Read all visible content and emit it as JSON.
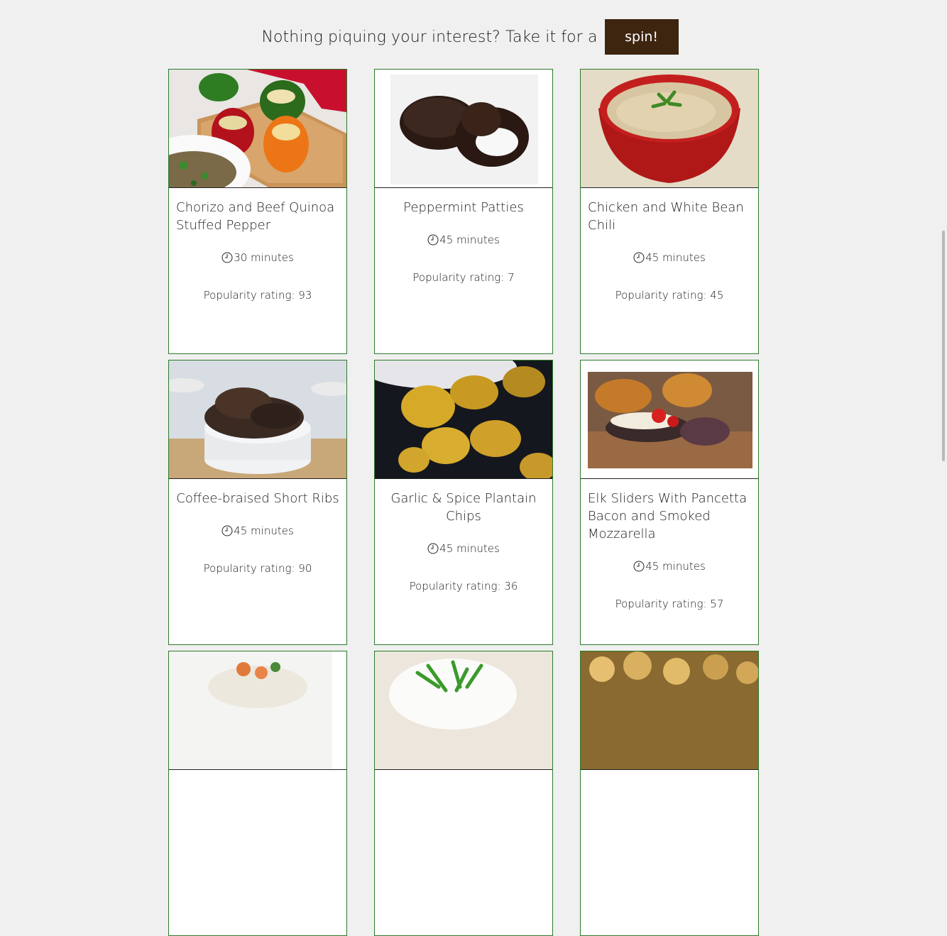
{
  "header": {
    "prompt": "Nothing piquing your interest? Take it for a",
    "spin_label": "spin!"
  },
  "recipes": [
    {
      "title": "Chorizo and Beef Quinoa Stuffed Pepper",
      "time": "30 minutes",
      "rating": "Popularity rating: 93"
    },
    {
      "title": "Peppermint Patties",
      "time": "45 minutes",
      "rating": "Popularity rating: 7"
    },
    {
      "title": "Chicken and White Bean Chili",
      "time": "45 minutes",
      "rating": "Popularity rating: 45"
    },
    {
      "title": "Coffee-braised Short Ribs",
      "time": "45 minutes",
      "rating": "Popularity rating: 90"
    },
    {
      "title": "Garlic & Spice Plantain Chips",
      "time": "45 minutes",
      "rating": "Popularity rating: 36"
    },
    {
      "title": "Elk Sliders With Pancetta Bacon and Smoked Mozzarella",
      "time": "45 minutes",
      "rating": "Popularity rating: 57"
    }
  ],
  "colors": {
    "spin_button": "#3d2510",
    "card_border": "#2d7a2d",
    "background": "#f0f0f0"
  }
}
